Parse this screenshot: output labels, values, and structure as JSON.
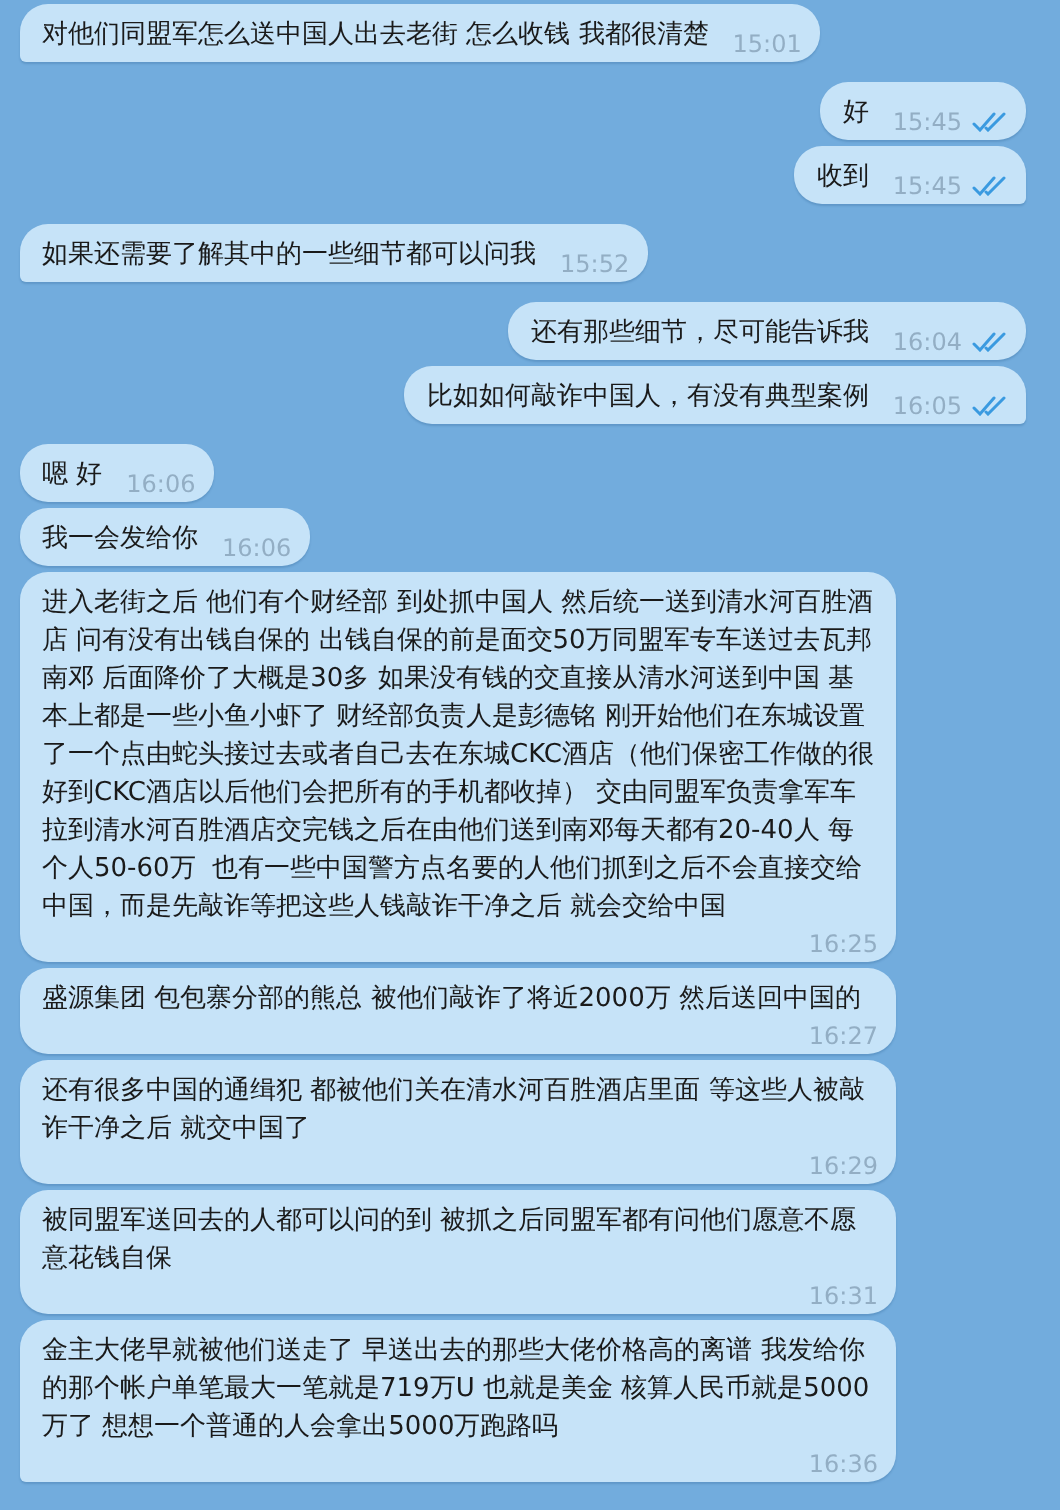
{
  "messages": [
    {
      "kind": "incoming",
      "text": "对他们同盟军怎么送中国人出去老街 怎么收钱 我都很清楚",
      "time": "15:01"
    },
    {
      "kind": "outgoing",
      "text": "好",
      "time": "15:45",
      "read": true
    },
    {
      "kind": "outgoing",
      "text": "收到",
      "time": "15:45",
      "read": true
    },
    {
      "kind": "incoming",
      "text": "如果还需要了解其中的一些细节都可以问我",
      "time": "15:52"
    },
    {
      "kind": "outgoing",
      "text": "还有那些细节，尽可能告诉我",
      "time": "16:04",
      "read": true
    },
    {
      "kind": "outgoing",
      "text": "比如如何敲诈中国人，有没有典型案例",
      "time": "16:05",
      "read": true
    },
    {
      "kind": "incoming",
      "text": "嗯 好",
      "time": "16:06"
    },
    {
      "kind": "incoming",
      "text": "我一会发给你",
      "time": "16:06"
    },
    {
      "kind": "incoming",
      "text": "进入老街之后 他们有个财经部 到处抓中国人 然后统一送到清水河百胜酒店 问有没有出钱自保的 出钱自保的前是面交50万同盟军专车送过去瓦邦南邓 后面降价了大概是30多 如果没有钱的交直接从清水河送到中国 基本上都是一些小鱼小虾了 财经部负责人是彭德铭 刚开始他们在东城设置了一个点由蛇头接过去或者自己去在东城CKC酒店（他们保密工作做的很好到CKC酒店以后他们会把所有的手机都收掉） 交由同盟军负责拿军车拉到清水河百胜酒店交完钱之后在由他们送到南邓每天都有20-40人 每个人50-60万  也有一些中国警方点名要的人他们抓到之后不会直接交给中国，而是先敲诈等把这些人钱敲诈干净之后 就会交给中国",
      "time": "16:25"
    },
    {
      "kind": "incoming",
      "text": "盛源集团 包包寨分部的熊总 被他们敲诈了将近2000万 然后送回中国的",
      "time": "16:27"
    },
    {
      "kind": "incoming",
      "text": "还有很多中国的通缉犯 都被他们关在清水河百胜酒店里面 等这些人被敲诈干净之后 就交中国了",
      "time": "16:29"
    },
    {
      "kind": "incoming",
      "text": "被同盟军送回去的人都可以问的到 被抓之后同盟军都有问他们愿意不愿意花钱自保",
      "time": "16:31"
    },
    {
      "kind": "incoming",
      "text": "金主大佬早就被他们送走了 早送出去的那些大佬价格高的离谱 我发给你的那个帐户单笔最大一笔就是719万U 也就是美金 核算人民币就是5000万了 想想一个普通的人会拿出5000万跑路吗",
      "time": "16:36"
    }
  ]
}
